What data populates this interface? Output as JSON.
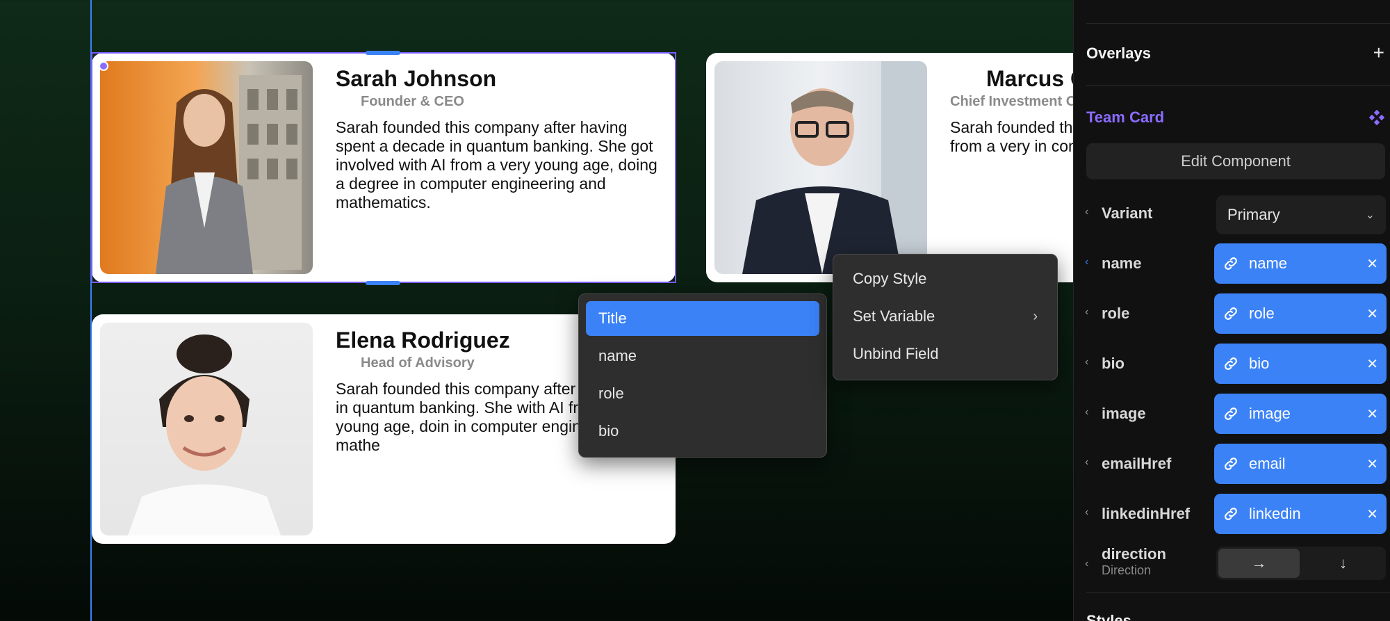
{
  "cards": [
    {
      "name": "Sarah Johnson",
      "role": "Founder & CEO",
      "bio": "Sarah founded this company after having spent a decade in quantum banking. She got involved with AI from a very young age, doing a degree in computer engineering and mathematics."
    },
    {
      "name": "Marcus Che",
      "role": "Chief Investment O",
      "bio": "Sarah founded thi a decade in quant with AI from a very in computer engin"
    },
    {
      "name": "Elena Rodriguez",
      "role": "Head of Advisory",
      "bio": "Sarah founded this company after h a decade in quantum banking. She with AI from a very young age, doin in computer engineering and mathe"
    }
  ],
  "field_menu": {
    "items": [
      "Title",
      "name",
      "role",
      "bio"
    ],
    "active_index": 0
  },
  "context_menu": {
    "copy_style": "Copy Style",
    "set_variable": "Set Variable",
    "unbind_field": "Unbind Field",
    "submenu_icon": "chevron-right-icon"
  },
  "panel": {
    "overlays_title": "Overlays",
    "component_title": "Team Card",
    "edit_component": "Edit Component",
    "variant_label": "Variant",
    "variant_value": "Primary",
    "bindings": [
      {
        "label": "name",
        "value": "name"
      },
      {
        "label": "role",
        "value": "role"
      },
      {
        "label": "bio",
        "value": "bio"
      },
      {
        "label": "image",
        "value": "image"
      },
      {
        "label": "emailHref",
        "value": "email"
      },
      {
        "label": "linkedinHref",
        "value": "linkedin"
      }
    ],
    "direction_label": "direction",
    "direction_sub": "Direction",
    "direction_options": [
      "→",
      "↓"
    ],
    "direction_active": 0,
    "styles_title": "Styles"
  },
  "colors": {
    "accent_blue": "#3b82f6",
    "selection_purple": "#7c5cff",
    "component_purple": "#8b6cff",
    "panel_bg": "#111111",
    "menu_bg": "#2e2e2e"
  }
}
